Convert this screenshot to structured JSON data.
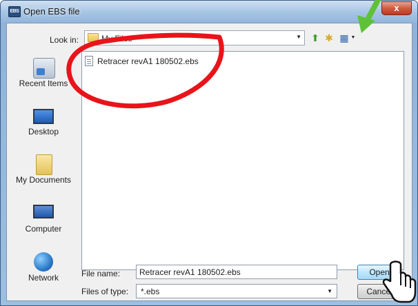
{
  "window": {
    "title": "Open EBS file",
    "close_label": "x"
  },
  "lookin": {
    "label": "Look in:",
    "value": "My Files"
  },
  "places": [
    {
      "label": "Recent Items",
      "icon": "recent-items-icon"
    },
    {
      "label": "Desktop",
      "icon": "desktop-icon"
    },
    {
      "label": "My Documents",
      "icon": "my-documents-icon"
    },
    {
      "label": "Computer",
      "icon": "computer-icon"
    },
    {
      "label": "Network",
      "icon": "network-icon"
    }
  ],
  "files": [
    {
      "name": "Retracer revA1 180502.ebs"
    }
  ],
  "file_name": {
    "label": "File name:",
    "value": "Retracer revA1 180502.ebs"
  },
  "file_type": {
    "label": "Files of type:",
    "value": "*.ebs"
  },
  "buttons": {
    "open": "Open",
    "cancel": "Cancel"
  },
  "annotations": {
    "circle_color": "#e8141a",
    "arrow_color": "#5fc13a"
  }
}
